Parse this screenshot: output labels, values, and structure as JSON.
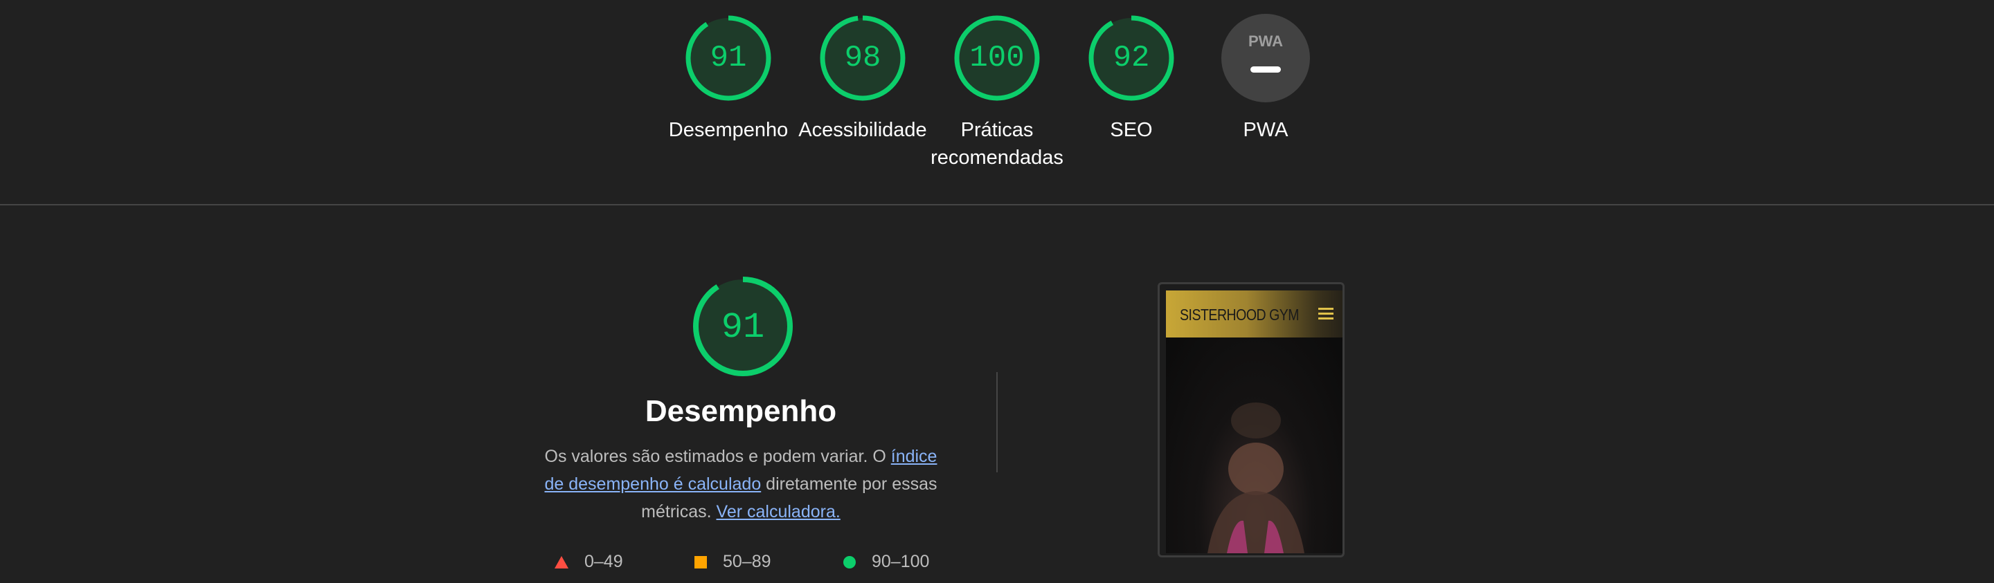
{
  "categories": [
    {
      "name": "Desempenho",
      "score": "91",
      "fraction": 0.91
    },
    {
      "name": "Acessibilidade",
      "score": "98",
      "fraction": 0.98
    },
    {
      "name": "Práticas\nrecomendadas",
      "score": "100",
      "fraction": 1.0
    },
    {
      "name": "SEO",
      "score": "92",
      "fraction": 0.92
    },
    {
      "name": "PWA",
      "badge": "PWA"
    }
  ],
  "performance": {
    "score": "91",
    "fraction": 0.91,
    "title": "Desempenho",
    "desc_text_1": "Os valores são estimados e podem variar. O ",
    "desc_link_1": "índice de desempenho é calculado",
    "desc_text_2": " diretamente por essas métricas. ",
    "desc_link_2": "Ver calculadora."
  },
  "legend": [
    {
      "label": "0–49",
      "shape": "triangle",
      "color": "#ff4e42"
    },
    {
      "label": "50–89",
      "shape": "square",
      "color": "#ffa400"
    },
    {
      "label": "90–100",
      "shape": "circle",
      "color": "#0cce6b"
    }
  ],
  "screenshot": {
    "site_title": "SISTERHOOD GYM"
  },
  "colors": {
    "pass": "#0cce6b",
    "gauge_bg_pass": "#1e3b29",
    "pwa_bg": "#424242",
    "link": "#8ab4f8"
  }
}
